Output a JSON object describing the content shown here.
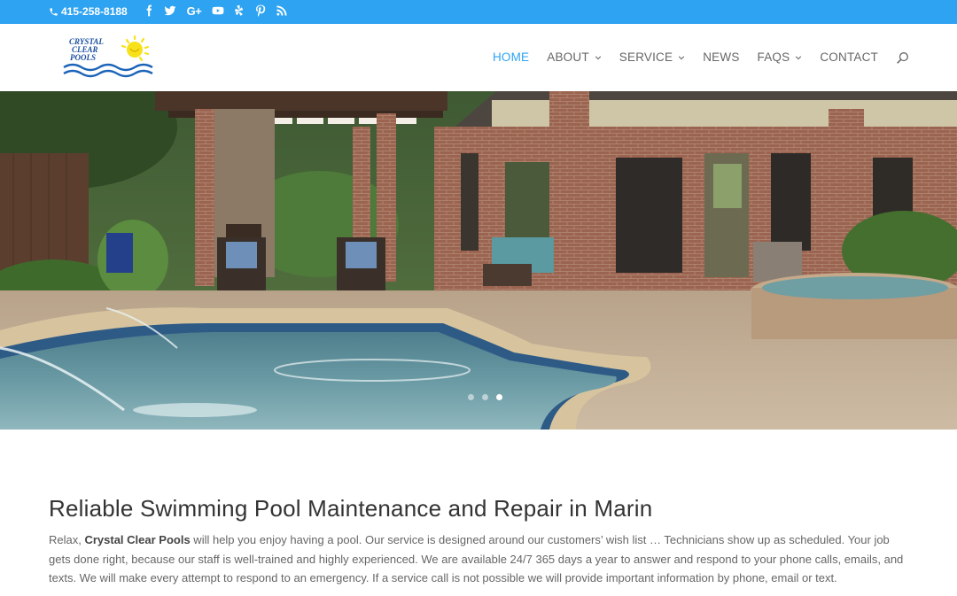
{
  "topbar": {
    "phone": "415-258-8188",
    "socials": [
      "facebook-icon",
      "twitter-icon",
      "google-plus-icon",
      "youtube-icon",
      "yelp-icon",
      "pinterest-icon",
      "rss-icon"
    ],
    "google_plus_glyph": "G+"
  },
  "logo": {
    "line1": "CRYSTAL",
    "line2": "CLEAR",
    "line3": "POOLS"
  },
  "nav": {
    "items": [
      {
        "label": "HOME",
        "active": true,
        "dropdown": false
      },
      {
        "label": "ABOUT",
        "active": false,
        "dropdown": true
      },
      {
        "label": "SERVICE",
        "active": false,
        "dropdown": true
      },
      {
        "label": "NEWS",
        "active": false,
        "dropdown": false
      },
      {
        "label": "FAQS",
        "active": false,
        "dropdown": true
      },
      {
        "label": "CONTACT",
        "active": false,
        "dropdown": false
      }
    ]
  },
  "slider": {
    "dots": 3,
    "active_dot": 3
  },
  "main": {
    "heading": "Reliable Swimming Pool Maintenance and Repair in Marin",
    "intro_pre": "Relax, ",
    "intro_bold": "Crystal Clear Pools",
    "intro_post": " will help you enjoy having a pool. Our service is designed around our customers’ wish list … Technicians show up as scheduled. Your job gets done right, because our staff is well-trained and highly experienced. We are available 24/7 365 days a year to answer and respond to your phone calls, emails, and texts.  We will make every attempt to respond to an emergency. If a service call is not possible we will provide important information by phone,  email or text."
  },
  "colors": {
    "accent": "#2ea3f2",
    "heading": "#333333",
    "body": "#666666"
  }
}
